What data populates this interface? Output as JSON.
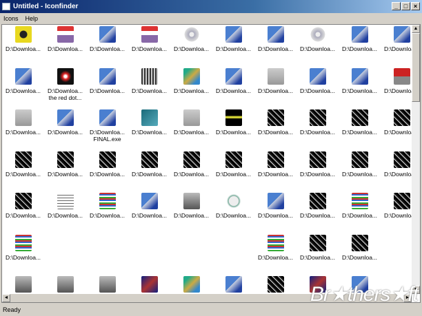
{
  "window": {
    "title": "Untitled - Iconfinder"
  },
  "menu": [
    "Icons",
    "Help"
  ],
  "grid": {
    "rows": [
      [
        {
          "i": "yellow",
          "l": "D:\\Downloa..."
        },
        {
          "i": "installer",
          "l": "D:\\Downloa..."
        },
        {
          "i": "setup",
          "l": "D:\\Downloa..."
        },
        {
          "i": "installer",
          "l": "D:\\Downloa..."
        },
        {
          "i": "cd",
          "l": "D:\\Downloa..."
        },
        {
          "i": "setup",
          "l": "D:\\Downloa..."
        },
        {
          "i": "setup",
          "l": "D:\\Downloa..."
        },
        {
          "i": "cd",
          "l": "D:\\Downloa..."
        },
        {
          "i": "setup",
          "l": "D:\\Downloa..."
        },
        {
          "i": "setup",
          "l": "D:\\Downloa..."
        }
      ],
      [
        {
          "i": "setup",
          "l": "D:\\Downloa..."
        },
        {
          "i": "reddot",
          "l": "D:\\Downloa...",
          "s": "the red dot..."
        },
        {
          "i": "setup",
          "l": "D:\\Downloa..."
        },
        {
          "i": "chip",
          "l": "D:\\Downloa..."
        },
        {
          "i": "map",
          "l": "D:\\Downloa..."
        },
        {
          "i": "setup",
          "l": "D:\\Downloa..."
        },
        {
          "i": "gray",
          "l": "D:\\Downloa..."
        },
        {
          "i": "setup",
          "l": "D:\\Downloa..."
        },
        {
          "i": "setup",
          "l": "D:\\Downloa..."
        },
        {
          "i": "floppy",
          "l": "D:\\Downloa..."
        }
      ],
      [
        {
          "i": "gray",
          "l": "D:\\Downloa..."
        },
        {
          "i": "setup",
          "l": "D:\\Downloa..."
        },
        {
          "i": "setup",
          "l": "D:\\Downloa...",
          "s": "FINAL.exe"
        },
        {
          "i": "teal",
          "l": "D:\\Downloa..."
        },
        {
          "i": "gray",
          "l": "D:\\Downloa..."
        },
        {
          "i": "darky",
          "l": "D:\\Downloa..."
        },
        {
          "i": "dark",
          "l": "D:\\Downloa..."
        },
        {
          "i": "dark",
          "l": "D:\\Downloa..."
        },
        {
          "i": "dark",
          "l": "D:\\Downloa..."
        },
        {
          "i": "dark",
          "l": "D:\\Downloa..."
        }
      ],
      [
        {
          "i": "dark",
          "l": "D:\\Downloa..."
        },
        {
          "i": "dark",
          "l": "D:\\Downloa..."
        },
        {
          "i": "dark",
          "l": "D:\\Downloa..."
        },
        {
          "i": "dark",
          "l": "D:\\Downloa..."
        },
        {
          "i": "dark",
          "l": "D:\\Downloa..."
        },
        {
          "i": "dark",
          "l": "D:\\Downloa..."
        },
        {
          "i": "dark",
          "l": "D:\\Downloa..."
        },
        {
          "i": "dark",
          "l": "D:\\Downloa..."
        },
        {
          "i": "dark",
          "l": "D:\\Downloa..."
        },
        {
          "i": "dark",
          "l": "D:\\Downloa..."
        }
      ],
      [
        {
          "i": "dark",
          "l": "D:\\Downloa..."
        },
        {
          "i": "list",
          "l": "D:\\Downloa..."
        },
        {
          "i": "color",
          "l": "D:\\Downloa..."
        },
        {
          "i": "setup",
          "l": "D:\\Downloa..."
        },
        {
          "i": "ship",
          "l": "D:\\Downloa..."
        },
        {
          "i": "bubble",
          "l": "D:\\Downloa..."
        },
        {
          "i": "setup",
          "l": "D:\\Downloa..."
        },
        {
          "i": "dark",
          "l": "D:\\Downloa..."
        },
        {
          "i": "color",
          "l": "D:\\Downloa..."
        },
        {
          "i": "dark",
          "l": "D:\\Downloa..."
        }
      ],
      [
        {
          "i": "color",
          "l": "D:\\Downloa..."
        },
        null,
        null,
        null,
        null,
        null,
        {
          "i": "color",
          "l": "D:\\Downloa..."
        },
        {
          "i": "dark",
          "l": "D:\\Downloa..."
        },
        {
          "i": "dark",
          "l": "D:\\Downloa..."
        },
        null
      ],
      [
        {
          "i": "ship",
          "l": ""
        },
        {
          "i": "ship",
          "l": ""
        },
        {
          "i": "ship",
          "l": ""
        },
        {
          "i": "navy",
          "l": ""
        },
        {
          "i": "map",
          "l": ""
        },
        {
          "i": "setup",
          "l": ""
        },
        {
          "i": "dark",
          "l": ""
        },
        {
          "i": "navy",
          "l": ""
        },
        {
          "i": "setup",
          "l": ""
        },
        null
      ]
    ]
  },
  "status": "Ready",
  "watermark": "Brothersoft"
}
